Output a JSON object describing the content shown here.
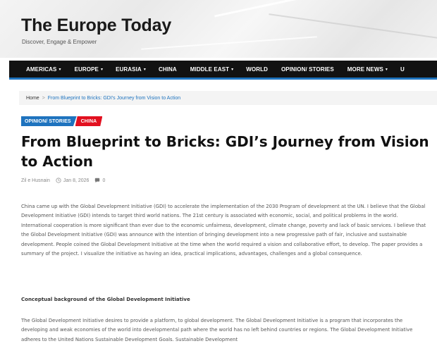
{
  "site": {
    "title": "The Europe Today",
    "tagline": "Discover, Engage & Empower"
  },
  "nav": {
    "items": [
      {
        "label": "AMERICAS",
        "dropdown": true
      },
      {
        "label": "EUROPE",
        "dropdown": true
      },
      {
        "label": "EURASIA",
        "dropdown": true
      },
      {
        "label": "CHINA",
        "dropdown": false
      },
      {
        "label": "MIDDLE EAST",
        "dropdown": true
      },
      {
        "label": "WORLD",
        "dropdown": false
      },
      {
        "label": "OPINION/ STORIES",
        "dropdown": false
      },
      {
        "label": "MORE NEWS",
        "dropdown": true
      },
      {
        "label": "U",
        "dropdown": false
      }
    ],
    "accent_color": "#1e73be"
  },
  "breadcrumb": {
    "home": "Home",
    "separator": ">",
    "current": "From Blueprint to Bricks: GDI's Journey from Vision to Action"
  },
  "categories": [
    {
      "label": "OPINION/ STORIES",
      "color": "#1e73be"
    },
    {
      "label": "CHINA",
      "color": "#e2101f"
    }
  ],
  "article": {
    "title": "From Blueprint to Bricks: GDI’s Journey from Vision to Action",
    "author": "Zil e Husnain",
    "date": "Jan 8, 2026",
    "comments": "0",
    "paragraph1": "China came up with the Global Development Initiative (GDI) to accelerate the implementation of the 2030 Program of development at the UN. I believe that the Global Development Initiative (GDI) intends to target third world nations. The 21st century is associated with economic, social, and political problems in the world. International cooperation is more significant than ever due to the economic unfairness, development, climate change, poverty and lack of basic services. I believe that the Global Development Initiative (GDI) was announce with the intention of bringing development into a new progressive path of fair, inclusive and sustainable development. People coined the Global Development Initiative at the time when the world required a vision and collaborative effort, to develop. The paper provides a summary of the project. I visualize the initiative as having an idea, practical implications, advantages, challenges and a global consequence.",
    "subheading": "Conceptual background of the Global Development Initiative",
    "paragraph2": "The Global Development Initiative desires to provide a platform, to global development. The Global Development Initiative is a program that incorporates the developing and weak economies of the world into developmental path where the world has no left behind countries or regions. The Global Development Initiative adheres to the United Nations Sustainable Development Goals. Sustainable Development"
  }
}
